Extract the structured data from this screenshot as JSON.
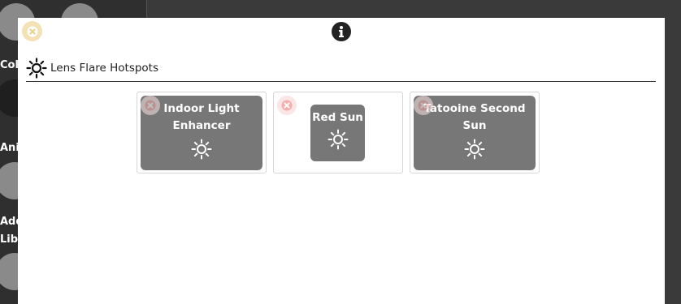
{
  "background": {
    "labels": [
      "Col",
      "Anir",
      "Add",
      "Libr"
    ]
  },
  "modal": {
    "header": {
      "title": "Lens Flare Hotspots",
      "icon": "sun-icon"
    },
    "close_icon": "close-icon",
    "info_icon": "info-icon",
    "hotspots": [
      {
        "label": "Indoor Light Enhancer",
        "icon": "sun-icon",
        "remove_icon": "remove-icon"
      },
      {
        "label": "Red Sun",
        "icon": "sun-icon",
        "remove_icon": "remove-icon"
      },
      {
        "label": "Tatooine Second Sun",
        "icon": "sun-icon",
        "remove_icon": "remove-icon"
      }
    ]
  },
  "colors": {
    "card_fill": "#777777",
    "close_bg": "#f3e2b6",
    "remove_bg": "#fbe3e3"
  }
}
